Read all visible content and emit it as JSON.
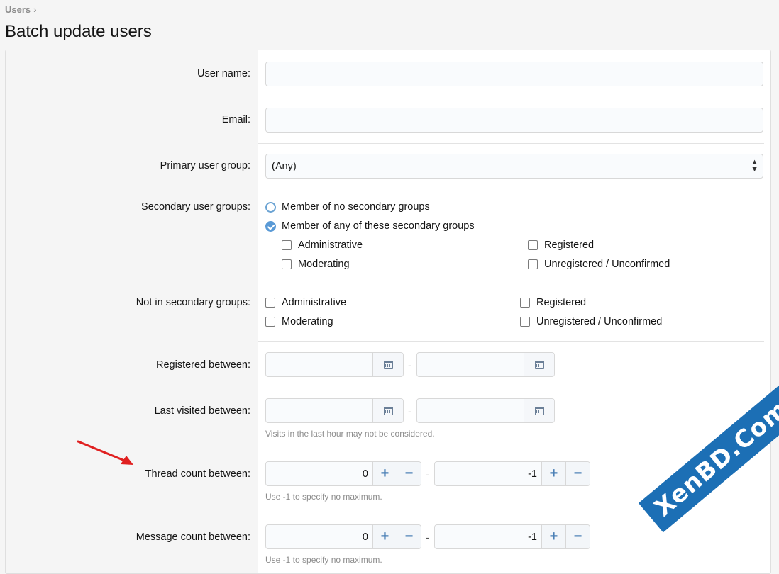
{
  "breadcrumb": {
    "link": "Users",
    "separator": "›"
  },
  "page_title": "Batch update users",
  "fields": {
    "user_name_label": "User name:",
    "email_label": "Email:",
    "primary_group_label": "Primary user group:",
    "primary_group_value": "(Any)",
    "secondary_groups_label": "Secondary user groups:",
    "secondary_radio_none": "Member of no secondary groups",
    "secondary_radio_any": "Member of any of these secondary groups",
    "not_secondary_label": "Not in secondary groups:",
    "groups": [
      "Administrative",
      "Registered",
      "Moderating",
      "Unregistered / Unconfirmed"
    ],
    "registered_between_label": "Registered between:",
    "last_visited_label": "Last visited between:",
    "last_visited_hint": "Visits in the last hour may not be considered.",
    "thread_count_label": "Thread count between:",
    "thread_min": "0",
    "thread_max": "-1",
    "thread_hint": "Use -1 to specify no maximum.",
    "message_count_label": "Message count between:",
    "message_min": "0",
    "message_max": "-1",
    "message_hint": "Use -1 to specify no maximum.",
    "range_dash": "-"
  },
  "watermark": "XenBD.Com",
  "colors": {
    "accent": "#5a9ad6",
    "annotation_arrow": "#e02020",
    "watermark_bg": "#1c6fb5"
  }
}
